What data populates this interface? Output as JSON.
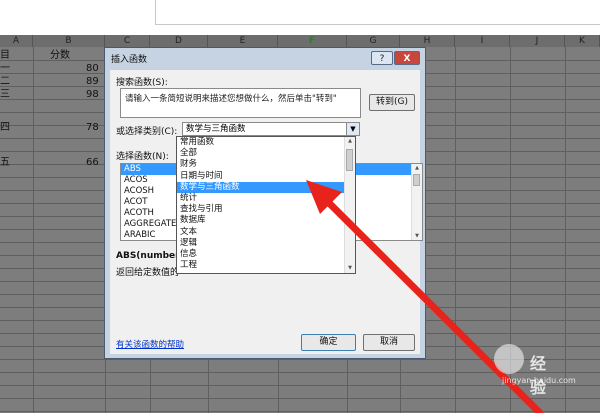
{
  "sheet": {
    "columns": [
      "A",
      "B",
      "C",
      "D",
      "E",
      "F",
      "G",
      "H",
      "I",
      "J",
      "K"
    ],
    "selected_column": "F",
    "cells": [
      {
        "text": "分数"
      },
      {
        "text": "目"
      },
      {
        "text": "一"
      },
      {
        "text": "二"
      },
      {
        "text": "三"
      },
      {
        "text": "80"
      },
      {
        "text": "89"
      },
      {
        "text": "98"
      },
      {
        "text": "四"
      },
      {
        "text": "78"
      },
      {
        "text": "五"
      },
      {
        "text": "66"
      }
    ]
  },
  "dialog": {
    "title": "插入函数",
    "help_button": "?",
    "close_button": "X",
    "search_label": "搜索函数(S):",
    "search_value": "请输入一条简短说明来描述您想做什么，然后单击\"转到\"",
    "goto_button": "转到(G)",
    "category_label": "或选择类别(C):",
    "category_value": "数学与三角函数",
    "function_label": "选择函数(N):",
    "functions": [
      "ABS",
      "ACOS",
      "ACOSH",
      "ACOT",
      "ACOTH",
      "AGGREGATE",
      "ARABIC"
    ],
    "selected_function": "ABS",
    "syntax": "ABS(number)",
    "description": "返回给定数值的",
    "help_link": "有关该函数的帮助",
    "ok_button": "确定",
    "cancel_button": "取消"
  },
  "category_dropdown": {
    "options": [
      "常用函数",
      "全部",
      "财务",
      "日期与时间",
      "数学与三角函数",
      "统计",
      "查找与引用",
      "数据库",
      "文本",
      "逻辑",
      "信息",
      "工程"
    ],
    "selected": "数学与三角函数"
  },
  "watermark": {
    "text": "经验",
    "sub": "jingyan.baidu.com"
  },
  "colors": {
    "selected": "#3399ff",
    "arrow": "#e8231c",
    "sheet": "#7d7d7d"
  }
}
